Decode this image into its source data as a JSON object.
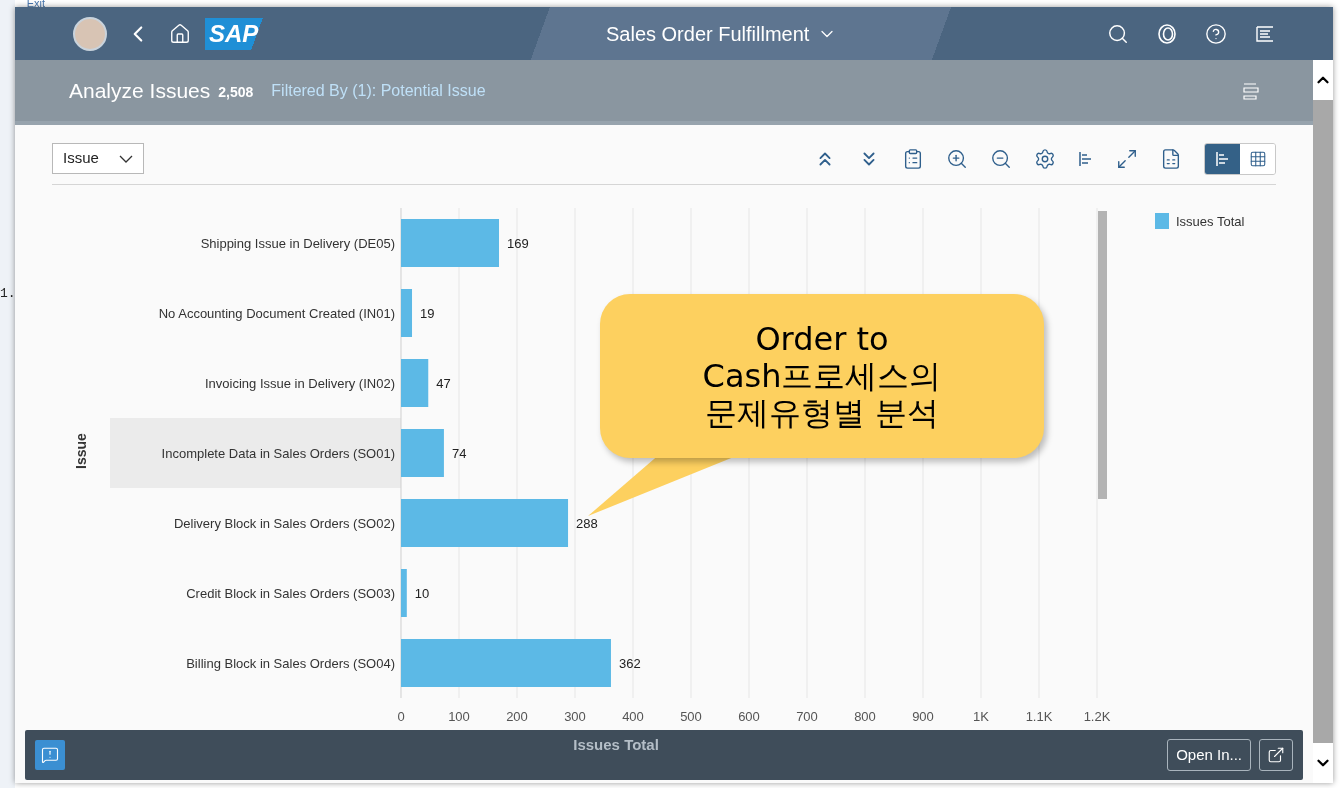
{
  "background_window": {
    "link": "Exit",
    "fragment": "1."
  },
  "shell": {
    "logo": "SAP",
    "title": "Sales Order Fulfillment"
  },
  "page": {
    "title": "Analyze Issues",
    "count": "2,508",
    "filter": "Filtered By (1): Potential Issue"
  },
  "toolbar": {
    "dimension": "Issue",
    "views": [
      {
        "kind": "chart",
        "selected": true
      },
      {
        "kind": "table",
        "selected": false
      }
    ]
  },
  "chart_data": {
    "type": "bar",
    "orientation": "horizontal",
    "xlabel": "Issues Total",
    "ylabel": "Issue",
    "categories": [
      "Shipping Issue in Delivery (DE05)",
      "No Accounting Document Created (IN01)",
      "Invoicing Issue in Delivery (IN02)",
      "Incomplete Data in Sales Orders (SO01)",
      "Delivery Block in Sales Orders (SO02)",
      "Credit Block in Sales Orders (SO03)",
      "Billing Block in Sales Orders (SO04)"
    ],
    "series": [
      {
        "name": "Issues Total",
        "color": "#5cb9e6",
        "values": [
          169,
          19,
          47,
          74,
          288,
          10,
          362
        ]
      }
    ],
    "xlim": [
      0,
      1200
    ],
    "xticks": [
      0,
      100,
      200,
      300,
      400,
      500,
      600,
      700,
      800,
      900,
      {
        "value": 1000,
        "label": "1K"
      },
      {
        "value": 1100,
        "label": "1.1K"
      },
      {
        "value": 1200,
        "label": "1.2K"
      }
    ],
    "data_labels": true,
    "grid": true
  },
  "chart_rows": [
    {
      "highlighted": false
    },
    {
      "highlighted": false
    },
    {
      "highlighted": false
    },
    {
      "highlighted": true
    },
    {
      "highlighted": false
    },
    {
      "highlighted": false
    },
    {
      "highlighted": false
    }
  ],
  "callout": {
    "lines": [
      "Order to",
      "Cash프로세스의",
      "문제유형별 분석"
    ]
  },
  "footer": {
    "open_in": "Open In..."
  }
}
